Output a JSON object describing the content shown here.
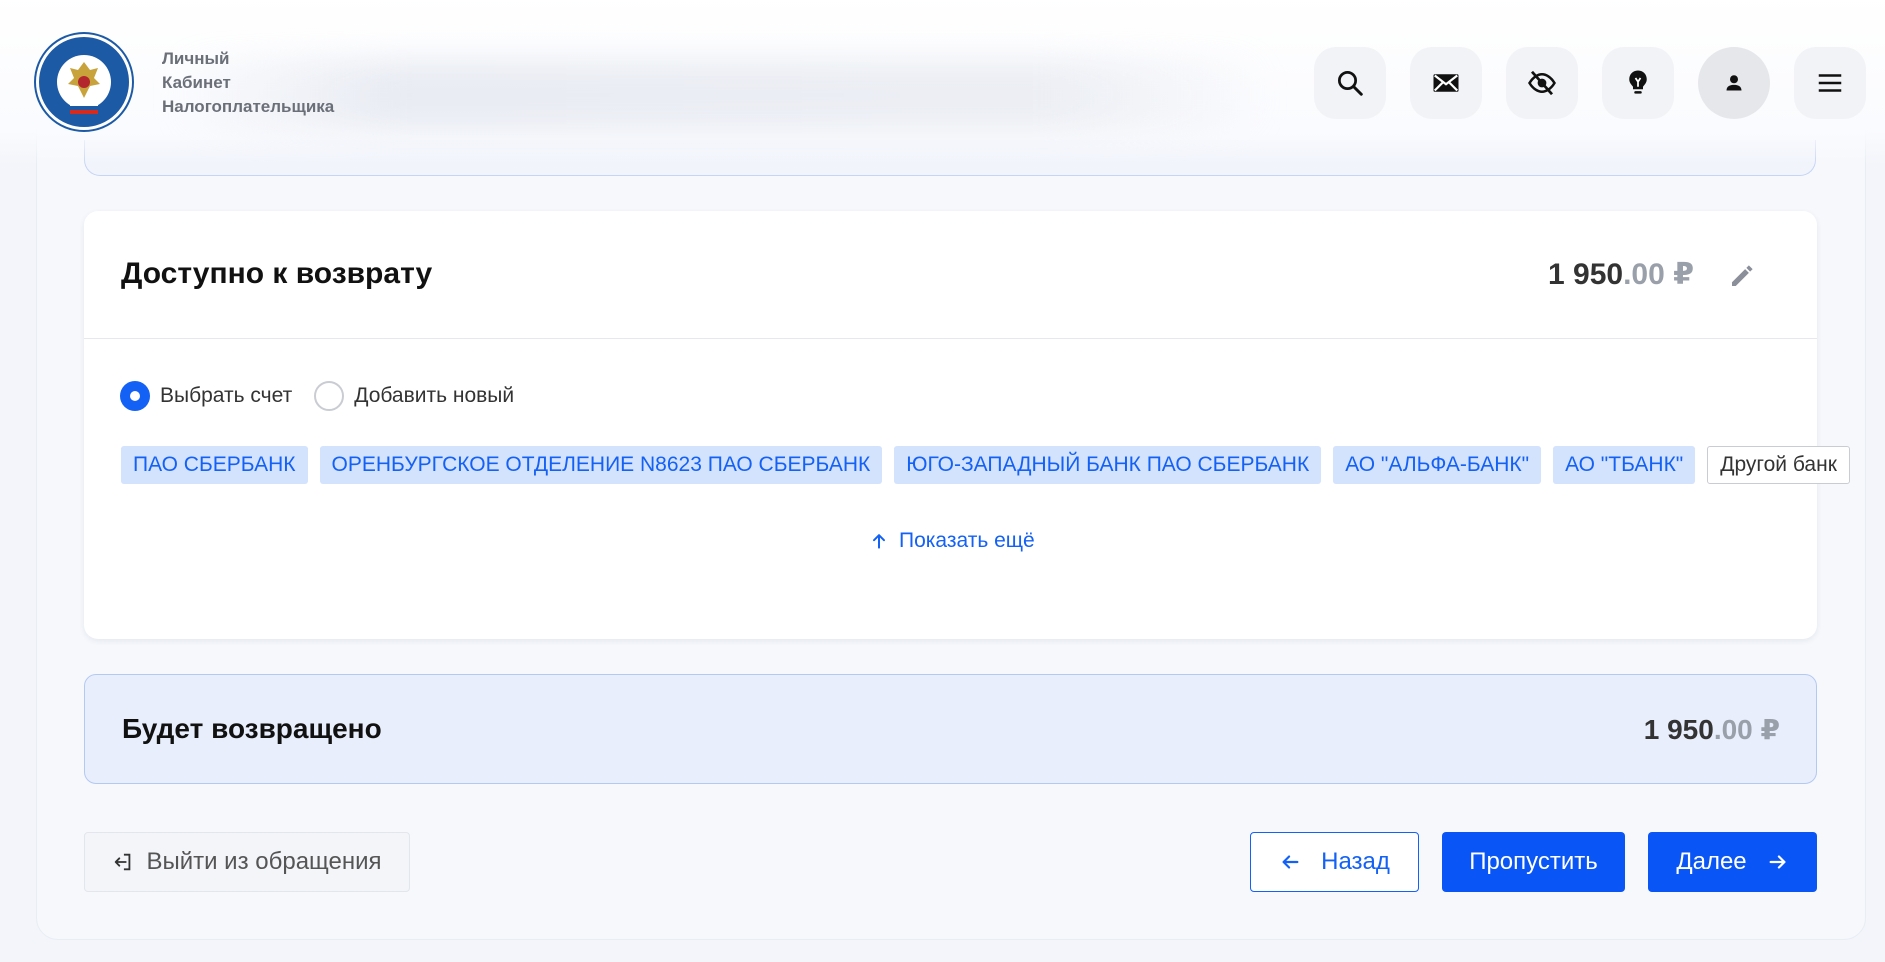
{
  "header": {
    "brand_lines": [
      "Личный",
      "Кабинет",
      "Налогоплательщика"
    ],
    "icons": [
      "search-icon",
      "mail-icon",
      "hide-icon",
      "lightbulb-icon",
      "user-icon",
      "menu-icon"
    ]
  },
  "refund_card": {
    "title": "Доступно к возврату",
    "amount_int": "1 950",
    "amount_dec": ".00 ₽",
    "account_options": [
      {
        "label": "Выбрать счет",
        "selected": true
      },
      {
        "label": "Добавить новый",
        "selected": false
      }
    ],
    "banks": [
      "ПАО СБЕРБАНК",
      "ОРЕНБУРГСКОЕ ОТДЕЛЕНИЕ N8623 ПАО СБЕРБАНК",
      "ЮГО-ЗАПАДНЫЙ БАНК ПАО СБЕРБАНК",
      "АО \"АЛЬФА-БАНК\"",
      "АО \"ТБАНК\""
    ],
    "other_bank": "Другой банк",
    "show_more": "Показать ещё"
  },
  "summary": {
    "title": "Будет возвращено",
    "amount_int": "1 950",
    "amount_dec": ".00 ₽"
  },
  "actions": {
    "exit": "Выйти из обращения",
    "back": "Назад",
    "skip": "Пропустить",
    "next": "Далее"
  },
  "colors": {
    "accent": "#1461f5",
    "chip_bg": "#d3e2fd",
    "summary_bg": "#e8eefb"
  }
}
